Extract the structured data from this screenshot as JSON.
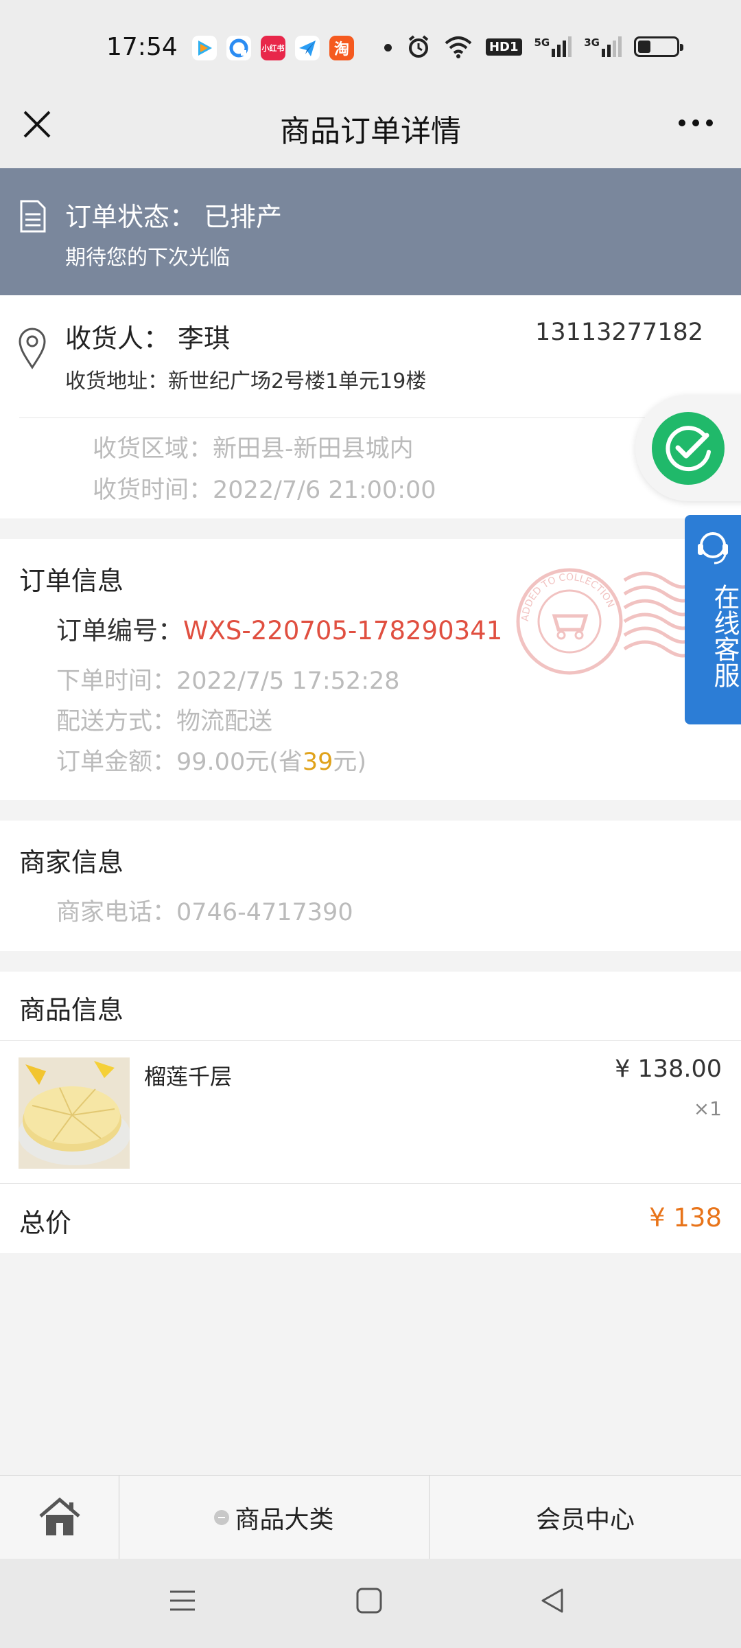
{
  "status_bar": {
    "time": "17:54",
    "apps": [
      {
        "icon": "tencent-video-icon",
        "color": "#ffffff"
      },
      {
        "icon": "browser-icon",
        "color": "#ffffff"
      },
      {
        "icon": "xiaohongshu-icon",
        "label": "小红书",
        "color": "#e8274a"
      },
      {
        "icon": "paper-plane-icon",
        "color": "#ffffff"
      },
      {
        "icon": "taobao-icon",
        "label": "淘",
        "color": "#f55a1f"
      }
    ],
    "indicators": [
      "alarm-icon",
      "wifi-icon",
      "hd-icon",
      "signal-5g-icon",
      "signal-3g-icon",
      "battery-icon"
    ],
    "hd_label": "HD1",
    "net1": "5G",
    "net2": "3G",
    "battery_level": 0.25
  },
  "navbar": {
    "title": "商品订单详情"
  },
  "order_status": {
    "label": "订单状态：",
    "value": "已排产",
    "message": "期待您的下次光临"
  },
  "receiver": {
    "name_label": "收货人：",
    "name": "李琪",
    "phone": "13113277182",
    "address_label": "收货地址：",
    "address": "新世纪广场2号楼1单元19楼",
    "area_label": "收货区域：",
    "area": "新田县-新田县城内",
    "time_label": "收货时间：",
    "time": "2022/7/6 21:00:00"
  },
  "order_info": {
    "title": "订单信息",
    "no_label": "订单编号：",
    "no": "WXS-220705-178290341",
    "created_label": "下单时间：",
    "created": "2022/7/5 17:52:28",
    "delivery_label": "配送方式：",
    "delivery": "物流配送",
    "amount_label": "订单金额：",
    "amount": "99.00元(省",
    "saved": "39",
    "amount_suffix": "元)",
    "stamp_text": "ADDED TO COLLECTION"
  },
  "merchant": {
    "title": "商家信息",
    "phone_label": "商家电话：",
    "phone": "0746-4717390"
  },
  "goods": {
    "title": "商品信息",
    "items": [
      {
        "name": "榴莲千层",
        "price": "¥ 138.00",
        "qty": "×1"
      }
    ],
    "total_label": "总价",
    "total": "¥ 138"
  },
  "floating": {
    "service_text": "在线客服"
  },
  "tabbar": {
    "category": "商品大类",
    "member": "会员中心"
  },
  "colors": {
    "banner": "#7a879c",
    "order_no": "#e04f40",
    "saved": "#e0a21a",
    "total": "#e8741a",
    "check": "#20b96a",
    "service": "#2c7dd6"
  }
}
